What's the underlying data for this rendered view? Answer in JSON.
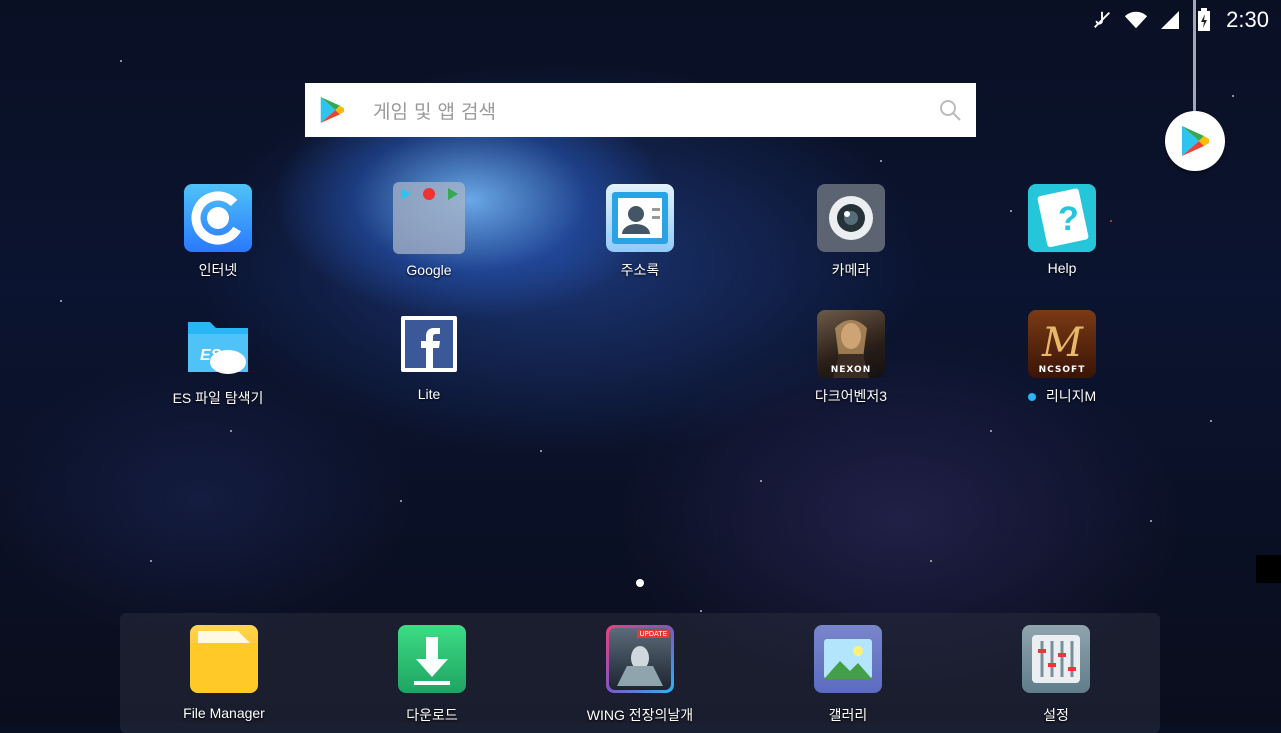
{
  "status_bar": {
    "time": "2:30"
  },
  "search": {
    "placeholder": "게임 및 앱 검색"
  },
  "apps": [
    {
      "label": "인터넷"
    },
    {
      "label": "Google"
    },
    {
      "label": "주소록"
    },
    {
      "label": "카메라"
    },
    {
      "label": "Help"
    },
    {
      "label": "ES 파일 탐색기"
    },
    {
      "label": "Lite"
    },
    {
      "label": "다크어벤저3",
      "badge": "NEXON"
    },
    {
      "label": "리니지M",
      "badge": "NCSOFT"
    }
  ],
  "dock": [
    {
      "label": "File Manager"
    },
    {
      "label": "다운로드"
    },
    {
      "label": "WING 전장의날개",
      "badge": "UPDATE"
    },
    {
      "label": "갤러리"
    },
    {
      "label": "설정"
    }
  ]
}
